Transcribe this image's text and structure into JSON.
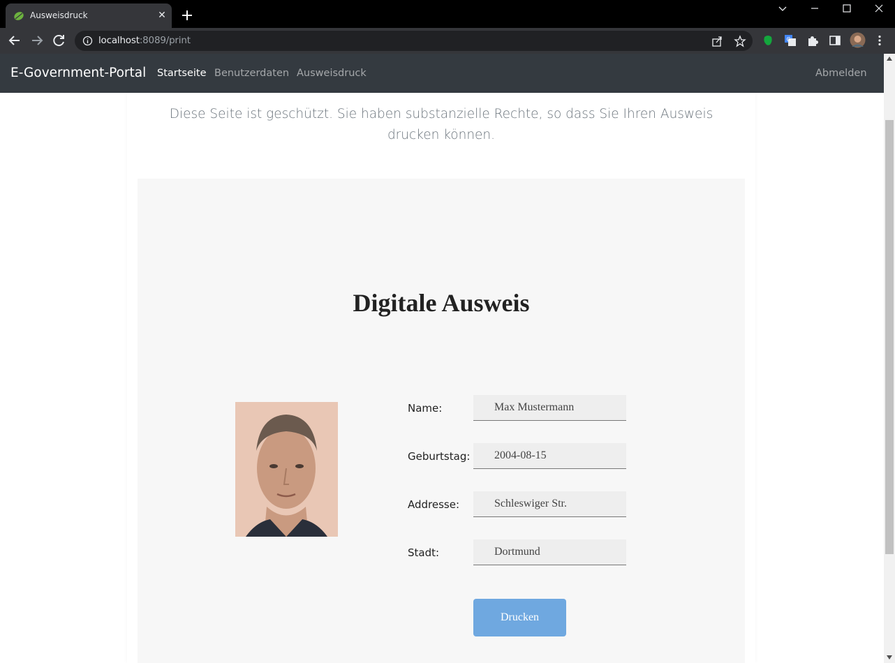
{
  "browser": {
    "tab_title": "Ausweisdruck",
    "url_host": "localhost",
    "url_rest": ":8089/print"
  },
  "navbar": {
    "brand": "E-Government-Portal",
    "links": [
      {
        "label": "Startseite",
        "active": true
      },
      {
        "label": "Benutzerdaten",
        "active": false
      },
      {
        "label": "Ausweisdruck",
        "active": false
      }
    ],
    "logout": "Abmelden",
    "background": "#343a40"
  },
  "page": {
    "lead": "Diese Seite ist geschützt. Sie haben substanzielle Rechte, so dass Sie Ihren Ausweis drucken können."
  },
  "card": {
    "title": "Digitale Ausweis",
    "fields": [
      {
        "label": "Name:",
        "value": "Max Mustermann"
      },
      {
        "label": "Geburtstag:",
        "value": "2004-08-15"
      },
      {
        "label": "Addresse:",
        "value": "Schleswiger Str."
      },
      {
        "label": "Stadt:",
        "value": "Dortmund"
      }
    ],
    "print_button": "Drucken",
    "button_color": "#6fa8e0"
  }
}
